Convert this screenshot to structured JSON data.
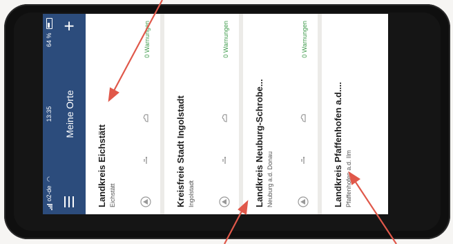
{
  "statusbar": {
    "carrier": "o2-de",
    "time": "13:35",
    "battery": "64 %"
  },
  "navbar": {
    "title": "Meine Orte",
    "menu_icon": "hamburger-menu-icon",
    "add_icon": "plus-icon"
  },
  "places": [
    {
      "title": "Landkreis Eichstätt",
      "subtitle": "Eichstätt",
      "warnings": "0 Warnungen"
    },
    {
      "title": "Kreisfreie Stadt Ingolstadt",
      "subtitle": "Ingolstadt",
      "warnings": "0 Warnungen"
    },
    {
      "title": "Landkreis Neuburg-Schrobe...",
      "subtitle": "Neuburg a.d. Donau",
      "warnings": "0 Warnungen"
    },
    {
      "title": "Landkreis Pfaffenhofen a.d....",
      "subtitle": "Pfaffenhofen a.d. Ilm",
      "warnings": ""
    }
  ],
  "row_icons": [
    "warning-triangle-icon",
    "weather-wind-icon",
    "weather-cloud-icon"
  ],
  "colors": {
    "header": "#2c4c7c",
    "warnings": "#3d9a4a",
    "arrow": "#e0584a"
  }
}
